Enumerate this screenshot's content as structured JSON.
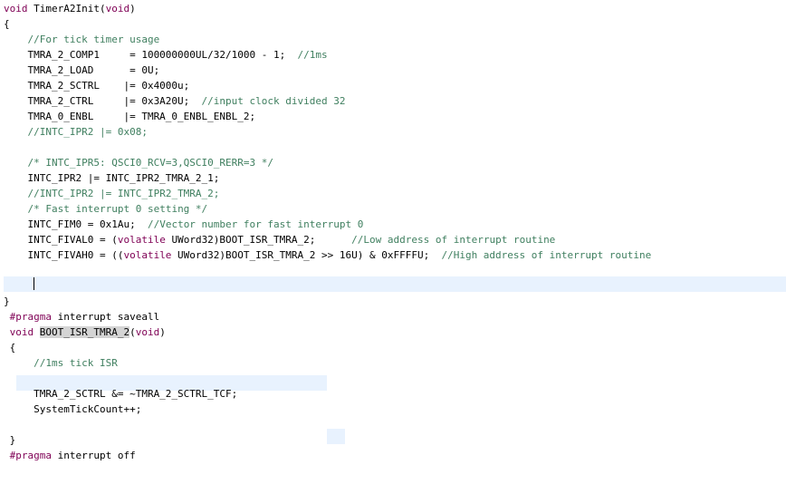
{
  "editor": {
    "lines": [
      [
        {
          "t": "void ",
          "k": "kw"
        },
        {
          "t": "TimerA2Init"
        },
        {
          "t": "("
        },
        {
          "t": "void",
          "k": "kw"
        },
        {
          "t": ")"
        }
      ],
      [
        {
          "t": "{"
        }
      ],
      [
        {
          "t": "    "
        },
        {
          "t": "//For tick timer usage",
          "k": "cm"
        }
      ],
      [
        {
          "t": "    TMRA_2_COMP1     = 100000000UL/32/1000 - 1;  "
        },
        {
          "t": "//1ms",
          "k": "cm"
        }
      ],
      [
        {
          "t": "    TMRA_2_LOAD      = 0U;"
        }
      ],
      [
        {
          "t": "    TMRA_2_SCTRL    |= 0x4000u;"
        }
      ],
      [
        {
          "t": "    TMRA_2_CTRL     |= 0x3A20U;  "
        },
        {
          "t": "//input clock divided 32",
          "k": "cm"
        }
      ],
      [
        {
          "t": "    TMRA_0_ENBL     |= TMRA_0_ENBL_ENBL_2;"
        }
      ],
      [
        {
          "t": "    "
        },
        {
          "t": "//INTC_IPR2 |= 0x08;",
          "k": "cm"
        }
      ],
      [
        {
          "t": ""
        }
      ],
      [
        {
          "t": "    "
        },
        {
          "t": "/* INTC_IPR5: QSCI0_RCV=3,QSCI0_RERR=3 */",
          "k": "cm"
        }
      ],
      [
        {
          "t": "    INTC_IPR2 |= INTC_IPR2_TMRA_2_1;"
        }
      ],
      [
        {
          "t": "    "
        },
        {
          "t": "//INTC_IPR2 |= INTC_IPR2_TMRA_2;",
          "k": "cm"
        }
      ],
      [
        {
          "t": "    "
        },
        {
          "t": "/* Fast interrupt 0 setting */",
          "k": "cm"
        }
      ],
      [
        {
          "t": "    INTC_FIM0 = 0x1Au;  "
        },
        {
          "t": "//Vector number for fast interrupt 0",
          "k": "cm"
        }
      ],
      [
        {
          "t": "    INTC_FIVAL0 = ("
        },
        {
          "t": "volatile",
          "k": "kw"
        },
        {
          "t": " UWord32)BOOT_ISR_TMRA_2;      "
        },
        {
          "t": "//Low address of interrupt routine",
          "k": "cm"
        }
      ],
      [
        {
          "t": "    INTC_FIVAH0 = (("
        },
        {
          "t": "volatile",
          "k": "kw"
        },
        {
          "t": " UWord32)BOOT_ISR_TMRA_2 >> 16U) & 0xFFFFU;  "
        },
        {
          "t": "//High address of interrupt routine",
          "k": "cm"
        }
      ],
      [
        {
          "t": ""
        }
      ],
      [
        {
          "t": ""
        }
      ],
      [
        {
          "t": "}"
        }
      ],
      [
        {
          "t": " "
        },
        {
          "t": "#pragma",
          "k": "pp"
        },
        {
          "t": " interrupt saveall"
        }
      ],
      [
        {
          "t": " "
        },
        {
          "t": "void",
          "k": "kw"
        },
        {
          "t": " "
        },
        {
          "t": "BOOT_ISR_TMRA_2",
          "k": "sel"
        },
        {
          "t": "("
        },
        {
          "t": "void",
          "k": "kw"
        },
        {
          "t": ")"
        }
      ],
      [
        {
          "t": " {"
        }
      ],
      [
        {
          "t": "     "
        },
        {
          "t": "//1ms tick ISR",
          "k": "cm"
        }
      ],
      [
        {
          "t": ""
        }
      ],
      [
        {
          "t": "     TMRA_2_SCTRL &= ~TMRA_2_SCTRL_TCF;"
        }
      ],
      [
        {
          "t": "     SystemTickCount++;"
        }
      ],
      [
        {
          "t": ""
        }
      ],
      [
        {
          "t": " }"
        }
      ],
      [
        {
          "t": " "
        },
        {
          "t": "#pragma",
          "k": "pp"
        },
        {
          "t": " interrupt off"
        }
      ]
    ]
  }
}
